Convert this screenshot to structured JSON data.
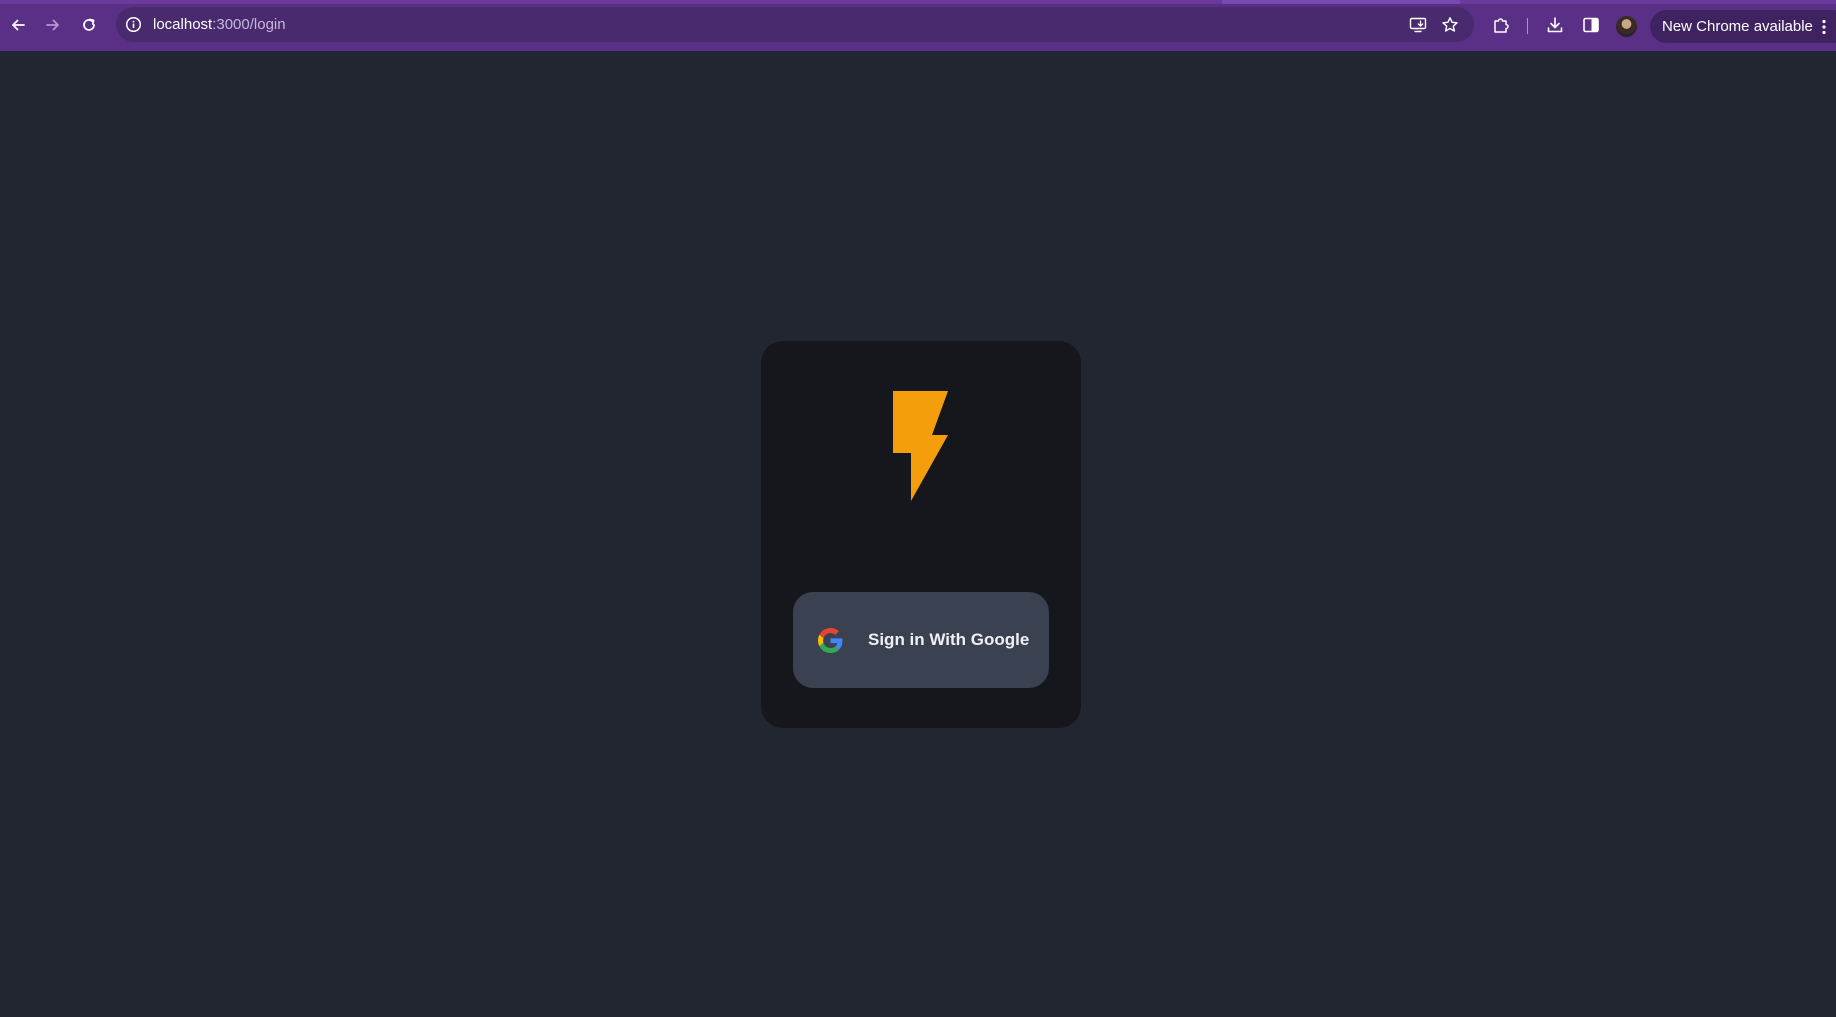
{
  "browser": {
    "url_host": "localhost",
    "url_path": ":3000/login",
    "update_chip_label": "New Chrome available",
    "colors": {
      "toolbar": "#5a2f86",
      "omnibox": "#4a2a6e",
      "chip": "#3e2360"
    },
    "icons": {
      "back": "back-arrow-icon",
      "forward": "forward-arrow-icon",
      "reload": "reload-icon",
      "site_info": "site-info-icon",
      "install": "install-app-icon",
      "bookmark": "bookmark-star-icon",
      "extensions": "extensions-puzzle-icon",
      "downloads": "downloads-icon",
      "side_panel": "side-panel-icon",
      "menu": "kebab-menu-icon"
    }
  },
  "login": {
    "logo": "lightning-bolt-logo",
    "sign_in_label": "Sign in With Google",
    "colors": {
      "page_bg": "#212631",
      "card_bg": "#15171c",
      "button_bg": "#3a4150",
      "bolt": "#f59e0b"
    }
  }
}
